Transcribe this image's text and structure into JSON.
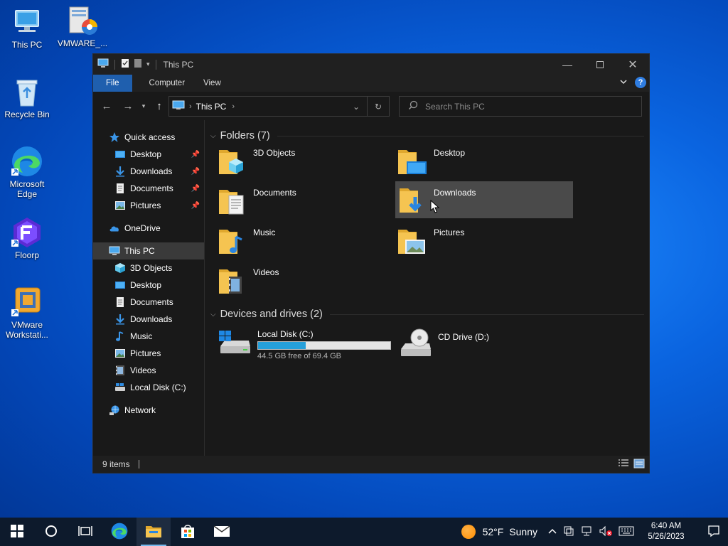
{
  "desktop": {
    "icons": [
      {
        "label": "This PC"
      },
      {
        "label": "VMWARE_..."
      },
      {
        "label": "Recycle Bin"
      },
      {
        "label": "Microsoft Edge"
      },
      {
        "label": "Floorp"
      },
      {
        "label": "VMware Workstati..."
      }
    ]
  },
  "window": {
    "title": "This PC",
    "ribbon": {
      "file": "File",
      "computer": "Computer",
      "view": "View",
      "help": "?"
    },
    "address": {
      "crumb": "This PC"
    },
    "search": {
      "placeholder": "Search This PC"
    },
    "sidebar": {
      "quick_access": "Quick access",
      "quick_items": [
        "Desktop",
        "Downloads",
        "Documents",
        "Pictures"
      ],
      "onedrive": "OneDrive",
      "this_pc": "This PC",
      "pc_items": [
        "3D Objects",
        "Desktop",
        "Documents",
        "Downloads",
        "Music",
        "Pictures",
        "Videos",
        "Local Disk (C:)"
      ],
      "network": "Network"
    },
    "folders_header": "Folders (7)",
    "folders": [
      "3D Objects",
      "Desktop",
      "Documents",
      "Downloads",
      "Music",
      "Pictures",
      "Videos"
    ],
    "devices_header": "Devices and drives (2)",
    "drives": [
      {
        "name": "Local Disk (C:)",
        "free": "44.5 GB free of 69.4 GB",
        "used_fraction": 0.36
      },
      {
        "name": "CD Drive (D:)"
      }
    ],
    "status": "9 items"
  },
  "taskbar": {
    "weather_temp": "52°F",
    "weather_text": "Sunny",
    "time": "6:40 AM",
    "date": "5/26/2023"
  },
  "colors": {
    "accent": "#1f5fae",
    "drive_fill": "#26a0da",
    "folder": "#f5c451"
  }
}
